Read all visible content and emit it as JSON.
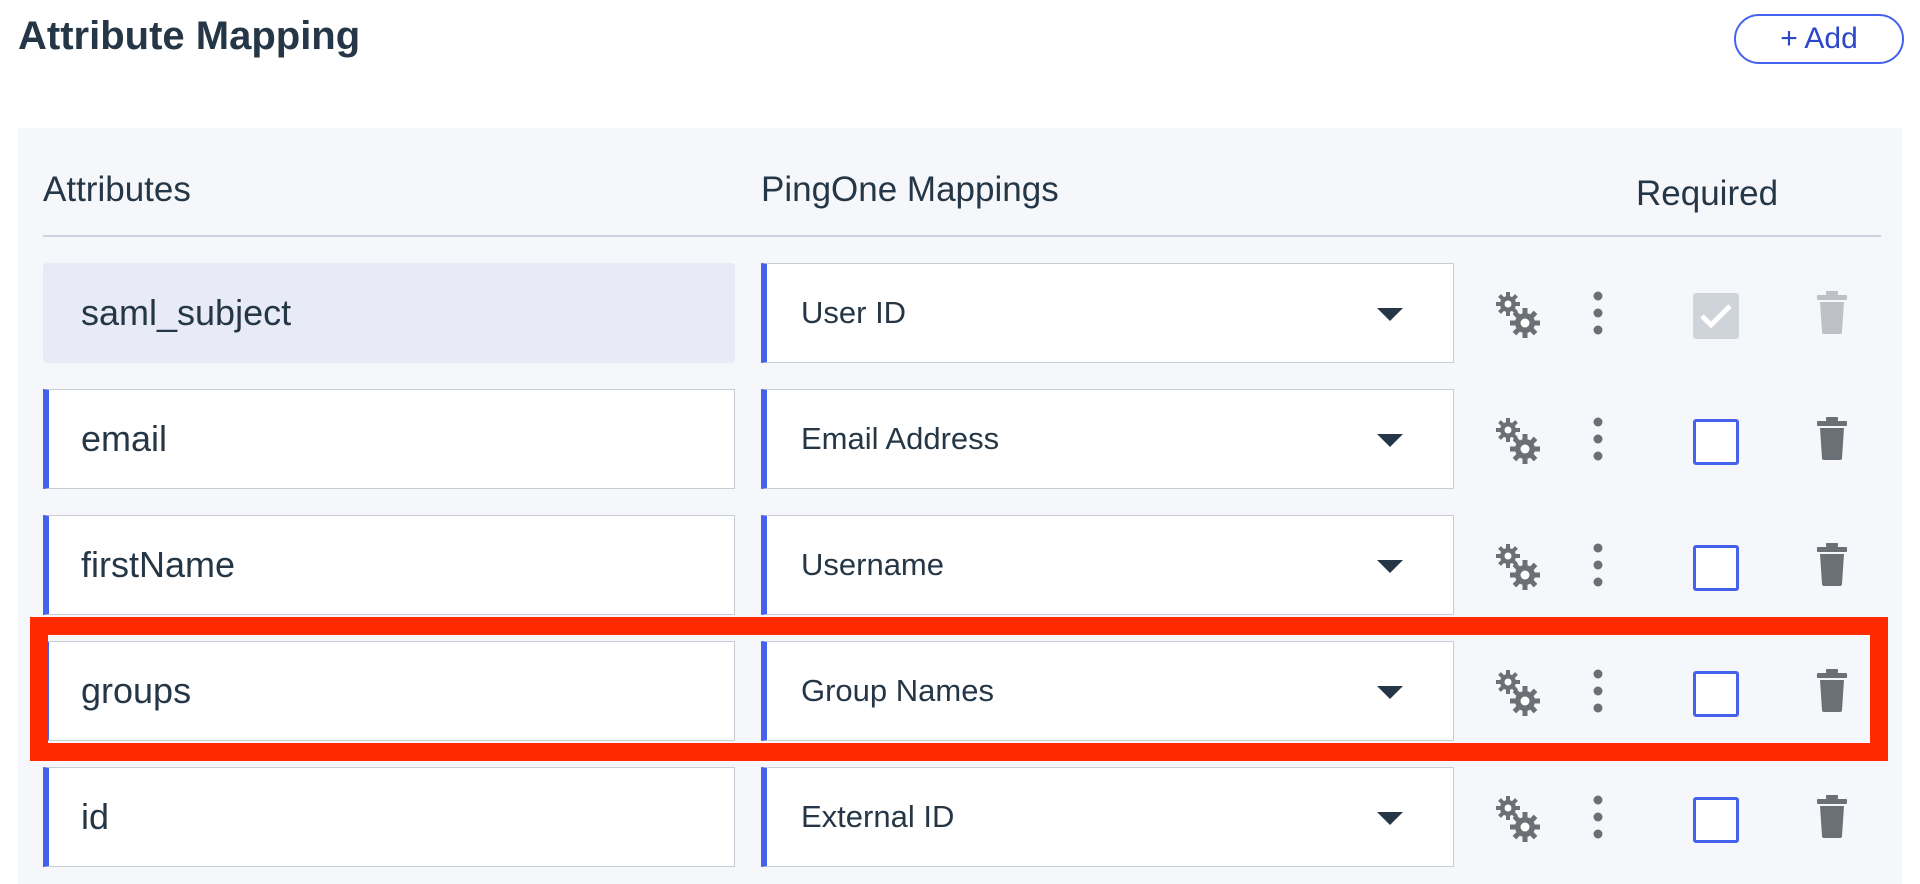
{
  "header": {
    "title": "Attribute Mapping",
    "add_label": "+ Add"
  },
  "table": {
    "columns": {
      "attributes": "Attributes",
      "mappings": "PingOne Mappings",
      "required": "Required"
    },
    "rows": [
      {
        "attribute": "saml_subject",
        "mapping": "User ID",
        "required": true,
        "locked": true
      },
      {
        "attribute": "email",
        "mapping": "Email Address",
        "required": false,
        "locked": false
      },
      {
        "attribute": "firstName",
        "mapping": "Username",
        "required": false,
        "locked": false
      },
      {
        "attribute": "groups",
        "mapping": "Group Names",
        "required": false,
        "locked": false,
        "highlighted": true
      },
      {
        "attribute": "id",
        "mapping": "External ID",
        "required": false,
        "locked": false
      }
    ]
  },
  "icons": {
    "advanced": "gears-icon",
    "more": "kebab-menu-icon",
    "delete": "trash-icon"
  },
  "colors": {
    "accent": "#4462ed",
    "highlight": "#ff2a00",
    "text": "#253746"
  }
}
